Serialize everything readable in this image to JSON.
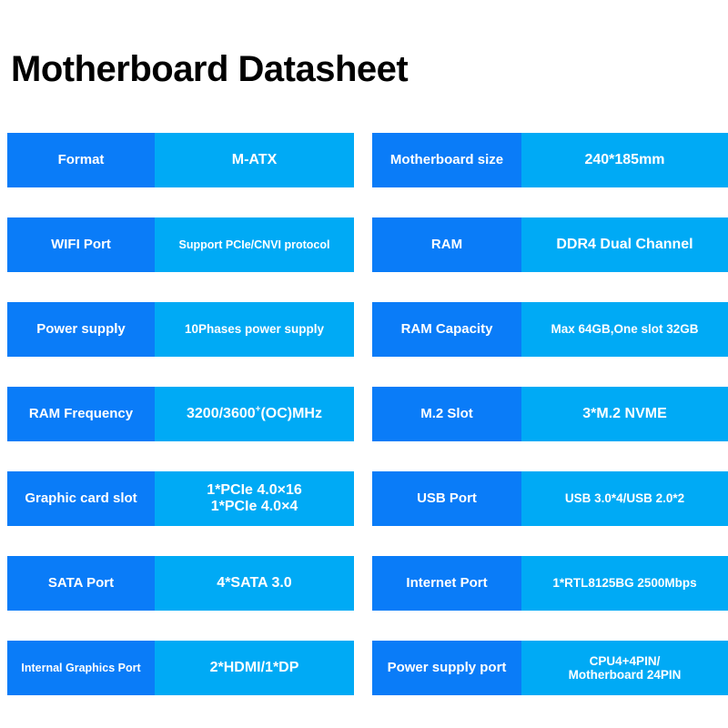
{
  "title": "Motherboard Datasheet",
  "colors": {
    "label_blue": "#0a7cf8",
    "value_blue": "#00aaf5",
    "text": "#ffffff",
    "title_text": "#000000",
    "background": "#ffffff"
  },
  "specs": {
    "rows": [
      {
        "left": {
          "label": "Format",
          "value": "M-ATX"
        },
        "right": {
          "label": "Motherboard size",
          "value": "240*185mm"
        }
      },
      {
        "left": {
          "label": "WIFI Port",
          "value": "Support PCIe/CNVI protocol"
        },
        "right": {
          "label": "RAM",
          "value": "DDR4 Dual Channel"
        }
      },
      {
        "left": {
          "label": "Power supply",
          "value": "10Phases power supply"
        },
        "right": {
          "label": "RAM Capacity",
          "value": "Max 64GB,One slot 32GB"
        }
      },
      {
        "left": {
          "label": "RAM Frequency",
          "value": "3200/3600+(OC)MHz",
          "value_parts": [
            "3200/3600",
            "+",
            "(OC)MHz"
          ]
        },
        "right": {
          "label": "M.2 Slot",
          "value": "3*M.2 NVME"
        }
      },
      {
        "left": {
          "label": "Graphic card slot",
          "value": "1*PCIe 4.0×16 1*PCIe 4.0×4",
          "value_lines": [
            "1*PCIe 4.0×16",
            "1*PCIe 4.0×4"
          ]
        },
        "right": {
          "label": "USB Port",
          "value": "USB 3.0*4/USB 2.0*2"
        }
      },
      {
        "left": {
          "label": "SATA Port",
          "value": "4*SATA 3.0"
        },
        "right": {
          "label": "Internet Port",
          "value": "1*RTL8125BG 2500Mbps"
        }
      },
      {
        "left": {
          "label": "Internal Graphics Port",
          "value": "2*HDMI/1*DP"
        },
        "right": {
          "label": "Power supply port",
          "value": "CPU4+4PIN/ Motherboard 24PIN",
          "value_lines": [
            "CPU4+4PIN/",
            "Motherboard 24PIN"
          ]
        }
      }
    ]
  }
}
